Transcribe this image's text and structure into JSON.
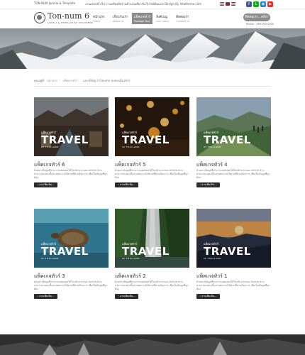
{
  "topbar": {
    "site": "TON-NUM Joomla & Template",
    "tagline": "งานแต่งหน้าเว็บ:วางเครื่องมือร้านค้าแบบเดียวกับเว็บไซต์ต้นแบบ Design By hitotheme.com",
    "flags": [
      "#c8102e",
      "#d00",
      "#2e4b9b",
      "#b22"
    ],
    "socials": [
      {
        "icon": "facebook-icon",
        "color": "#3b5998",
        "glyph": "f"
      },
      {
        "icon": "line-icon",
        "color": "#00b900",
        "glyph": "L"
      },
      {
        "icon": "instagram-icon",
        "color": "#2a7ee0",
        "glyph": "◉"
      },
      {
        "icon": "youtube-icon",
        "color": "#e52d27",
        "glyph": "▶"
      }
    ]
  },
  "header": {
    "logo_name": "Ton-num 6",
    "logo_sub": "JOOMLA & TEMPLATE BY HITOTHEME",
    "nav": [
      {
        "main": "หน้าแรก",
        "eng": "Home",
        "active": false
      },
      {
        "main": "เกี่ยวกับเรา",
        "eng": "About us",
        "active": false
      },
      {
        "main": "แพ็คเกจทัวร์",
        "eng": "Package Tour",
        "active": true
      },
      {
        "main": "ลิงค์เมนู",
        "eng": "Link menu",
        "active": false
      },
      {
        "main": "ติดต่อเรา",
        "eng": "Contact us",
        "active": false
      }
    ],
    "contact_button": "ติดต่อเรา...คลิก!",
    "phone": "Phone : 089-000-0000"
  },
  "breadcrumb": [
    "คุณอยู่ที่:",
    "หน้าแรก",
    "แพ็คเกจทัวร์",
    "แบบ Blog 3 Column (แสดงเต็มหน้า)"
  ],
  "cards": [
    {
      "title": "แพ็คเกจทัวร์ 6",
      "scene": "market",
      "desc": "ตัวอย่างข้อมูลที่สามารถแสดงผลได้ในหน้าแรกของ Article ท่านสามารถแสดงเนื้อหาบทความได้ตามที่ท่านต้องการ เพื่อเป็นข้อมูลที่ถูกต้อง"
    },
    {
      "title": "แพ็คเกจทัวร์ 5",
      "scene": "lanterns",
      "desc": "ตัวอย่างข้อมูลที่สามารถแสดงผลได้ในหน้าแรกของ Article ท่านสามารถแสดงเนื้อหาบทความได้ตามที่ท่านต้องการ เพื่อเป็นข้อมูลที่ถูกต้อง"
    },
    {
      "title": "แพ็คเกจทัวร์ 4",
      "scene": "hills",
      "desc": "ตัวอย่างข้อมูลที่สามารถแสดงผลได้ในหน้าแรกของ Article ท่านสามารถแสดงเนื้อหาบทความได้ตามที่ท่านต้องการ เพื่อเป็นข้อมูลที่ถูกต้อง"
    },
    {
      "title": "แพ็คเกจทัวร์ 3",
      "scene": "turtle",
      "desc": "ตัวอย่างข้อมูลที่สามารถแสดงผลได้ในหน้าแรกของ Article ท่านสามารถแสดงเนื้อหาบทความได้ตามที่ท่านต้องการ เพื่อเป็นข้อมูลที่ถูกต้อง"
    },
    {
      "title": "แพ็คเกจทัวร์ 2",
      "scene": "waterfall",
      "desc": "ตัวอย่างข้อมูลที่สามารถแสดงผลได้ในหน้าแรกของ Article ท่านสามารถแสดงเนื้อหาบทความได้ตามที่ท่านต้องการ เพื่อเป็นข้อมูลที่ถูกต้อง"
    },
    {
      "title": "แพ็คเกจทัวร์ 1",
      "scene": "sunset",
      "desc": "ตัวอย่างข้อมูลที่สามารถแสดงผลได้ในหน้าแรกของ Article ท่านสามารถแสดงเนื้อหาบทความได้ตามที่ท่านต้องการ เพื่อเป็นข้อมูลที่ถูกต้อง"
    }
  ],
  "overlay": {
    "small": "แพ็คเกจทัวร์",
    "big": "TRAVEL",
    "in": "IN THAILAND"
  },
  "read_more": "อ่านเพิ่มเติม...",
  "colors": {
    "accent": "#8a8a8a",
    "button_dark": "#2b2b2b",
    "footer": "#2e2e2e"
  }
}
